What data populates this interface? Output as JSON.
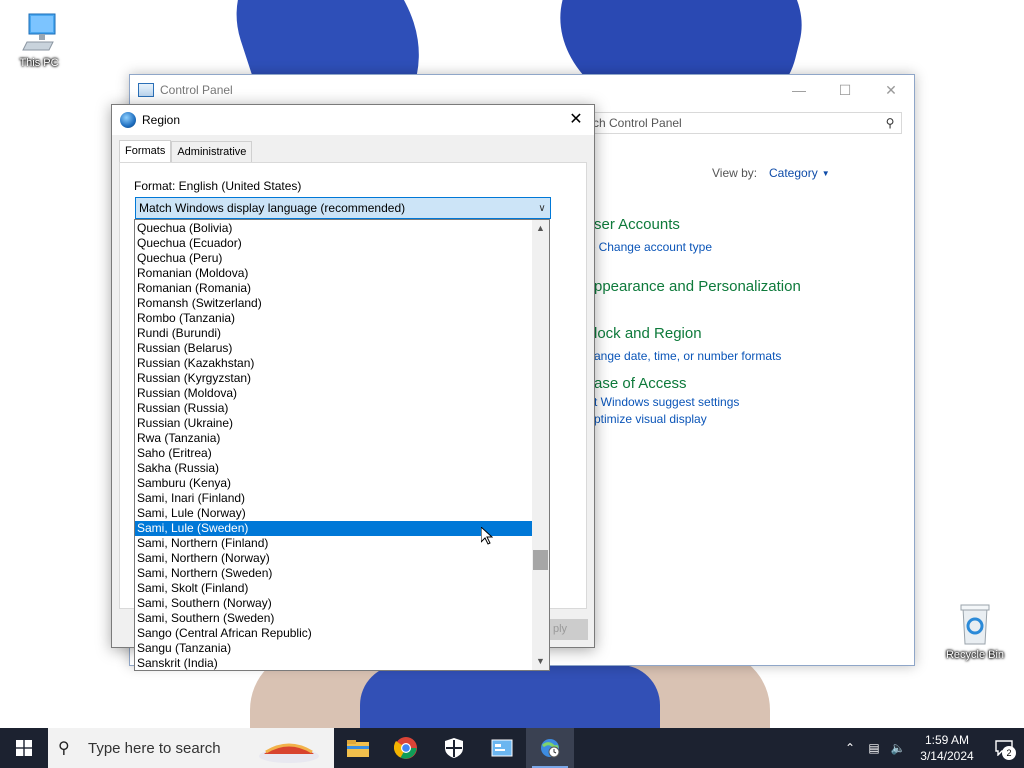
{
  "desktop": {
    "icons": [
      {
        "label": "This PC"
      },
      {
        "label": "Recycle Bin"
      }
    ]
  },
  "control_panel": {
    "title": "Control Panel",
    "search_text": "ch Control Panel",
    "view_by_label": "View by:",
    "view_by_value": "Category",
    "categories": [
      {
        "title": "ser Accounts",
        "links": [
          "Change account type"
        ]
      },
      {
        "title": "ppearance and Personalization",
        "links": []
      },
      {
        "title": "lock and Region",
        "links": [
          "ange date, time, or number formats"
        ]
      },
      {
        "title": "ase of Access",
        "links": [
          "t Windows suggest settings",
          "ptimize visual display"
        ]
      }
    ]
  },
  "region_dialog": {
    "title": "Region",
    "tabs": [
      "Formats",
      "Administrative"
    ],
    "active_tab": "Formats",
    "format_label": "Format: English (United States)",
    "format_selected": "Match Windows display language (recommended)",
    "apply_button": "ply",
    "dropdown_options": [
      "Quechua (Bolivia)",
      "Quechua (Ecuador)",
      "Quechua (Peru)",
      "Romanian (Moldova)",
      "Romanian (Romania)",
      "Romansh (Switzerland)",
      "Rombo (Tanzania)",
      "Rundi (Burundi)",
      "Russian (Belarus)",
      "Russian (Kazakhstan)",
      "Russian (Kyrgyzstan)",
      "Russian (Moldova)",
      "Russian (Russia)",
      "Russian (Ukraine)",
      "Rwa (Tanzania)",
      "Saho (Eritrea)",
      "Sakha (Russia)",
      "Samburu (Kenya)",
      "Sami, Inari (Finland)",
      "Sami, Lule (Norway)",
      "Sami, Lule (Sweden)",
      "Sami, Northern (Finland)",
      "Sami, Northern (Norway)",
      "Sami, Northern (Sweden)",
      "Sami, Skolt (Finland)",
      "Sami, Southern (Norway)",
      "Sami, Southern (Sweden)",
      "Sango (Central African Republic)",
      "Sangu (Tanzania)",
      "Sanskrit (India)"
    ],
    "highlighted_option": "Sami, Lule (Sweden)"
  },
  "taskbar": {
    "search_placeholder": "Type here to search",
    "apps": [
      "file-explorer",
      "chrome",
      "windows-security",
      "control-panel",
      "region-settings"
    ],
    "time": "1:59 AM",
    "date": "3/14/2024",
    "notification_count": "2"
  },
  "colors": {
    "accent": "#0078d7",
    "taskbar": "#1c2230",
    "cp_category": "#0e7a3b",
    "link": "#0b55b8"
  }
}
